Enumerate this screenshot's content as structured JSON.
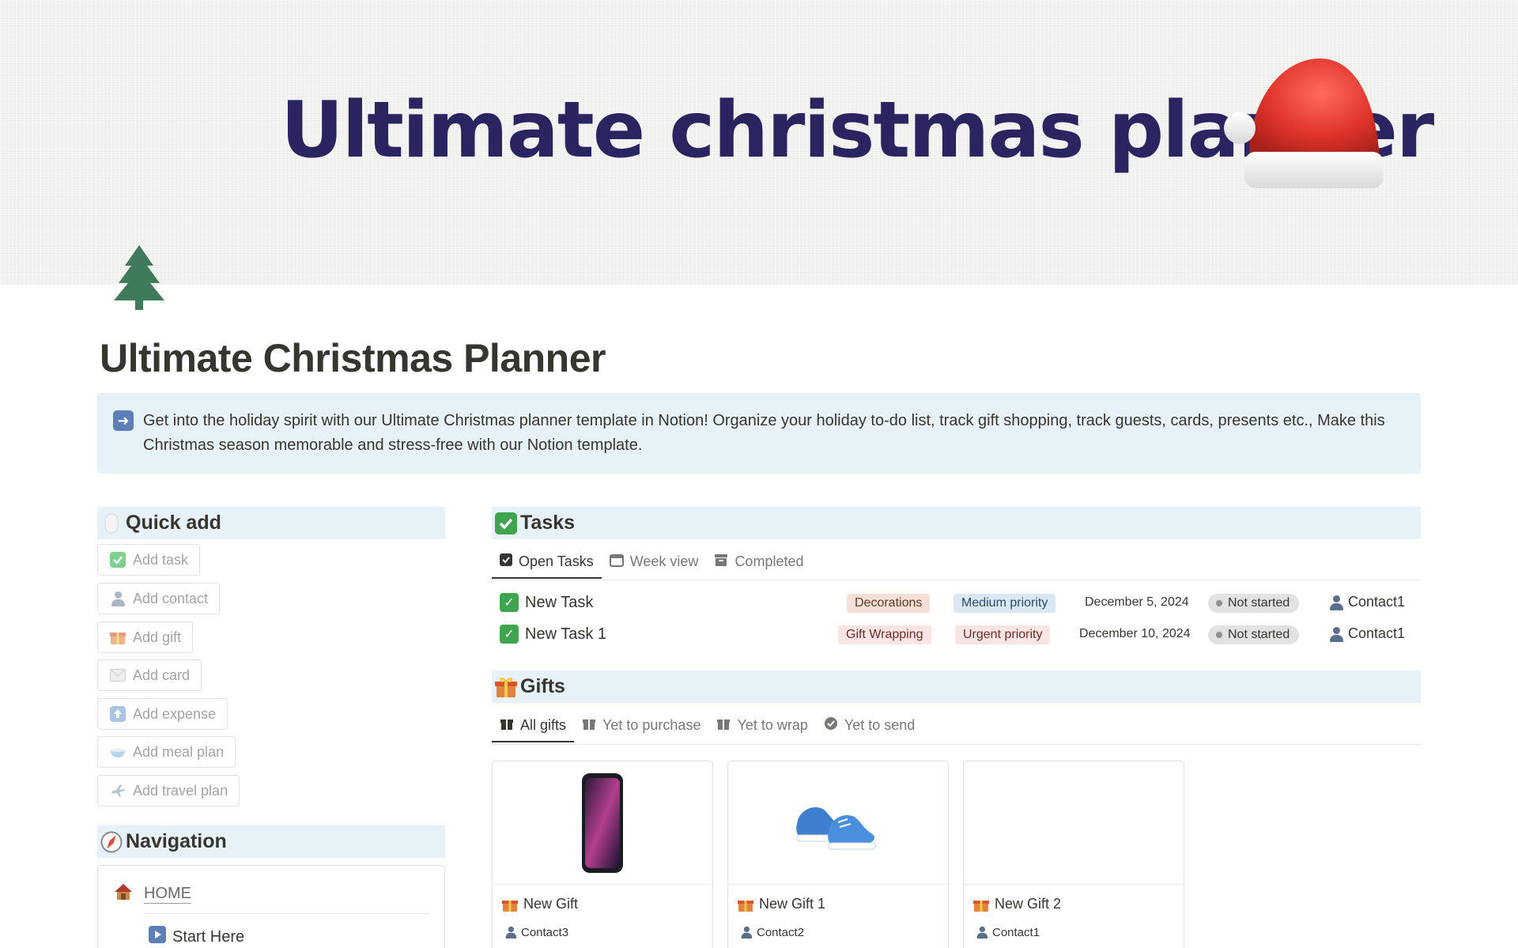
{
  "cover": {
    "title": "Ultimate christmas planner"
  },
  "page": {
    "title": "Ultimate Christmas Planner",
    "callout": "Get into the holiday spirit with our Ultimate Christmas planner template in Notion! Organize your holiday to-do list, track gift shopping, track guests, cards, presents etc., Make this Christmas season memorable and stress-free with our Notion template."
  },
  "quick_add": {
    "title": "Quick add",
    "buttons": [
      {
        "label": "Add task",
        "icon": "check-icon"
      },
      {
        "label": "Add contact",
        "icon": "person-icon"
      },
      {
        "label": "Add gift",
        "icon": "gift-icon"
      },
      {
        "label": "Add card",
        "icon": "envelope-icon"
      },
      {
        "label": "Add expense",
        "icon": "upload-icon"
      },
      {
        "label": "Add meal plan",
        "icon": "bowl-icon"
      },
      {
        "label": "Add travel plan",
        "icon": "airplane-icon"
      }
    ]
  },
  "navigation": {
    "title": "Navigation",
    "home": "HOME",
    "start": "Start Here"
  },
  "tasks": {
    "title": "Tasks",
    "tabs": [
      "Open Tasks",
      "Week view",
      "Completed"
    ],
    "rows": [
      {
        "name": "New Task",
        "category": "Decorations",
        "priority": "Medium priority",
        "date": "December 5, 2024",
        "status": "Not started",
        "contact": "Contact1"
      },
      {
        "name": "New Task 1",
        "category": "Gift Wrapping",
        "priority": "Urgent priority",
        "date": "December 10, 2024",
        "status": "Not started",
        "contact": "Contact1"
      }
    ]
  },
  "gifts": {
    "title": "Gifts",
    "tabs": [
      "All gifts",
      "Yet to purchase",
      "Yet to wrap",
      "Yet to send"
    ],
    "cards": [
      {
        "name": "New Gift",
        "contact": "Contact3",
        "image": "phone"
      },
      {
        "name": "New Gift 1",
        "contact": "Contact2",
        "image": "sneakers"
      },
      {
        "name": "New Gift 2",
        "contact": "Contact1",
        "image": "none"
      }
    ]
  },
  "colors": {
    "cover_title": "#2a2560",
    "section_bg": "#e7f1f8",
    "check_green": "#3ea44e"
  }
}
